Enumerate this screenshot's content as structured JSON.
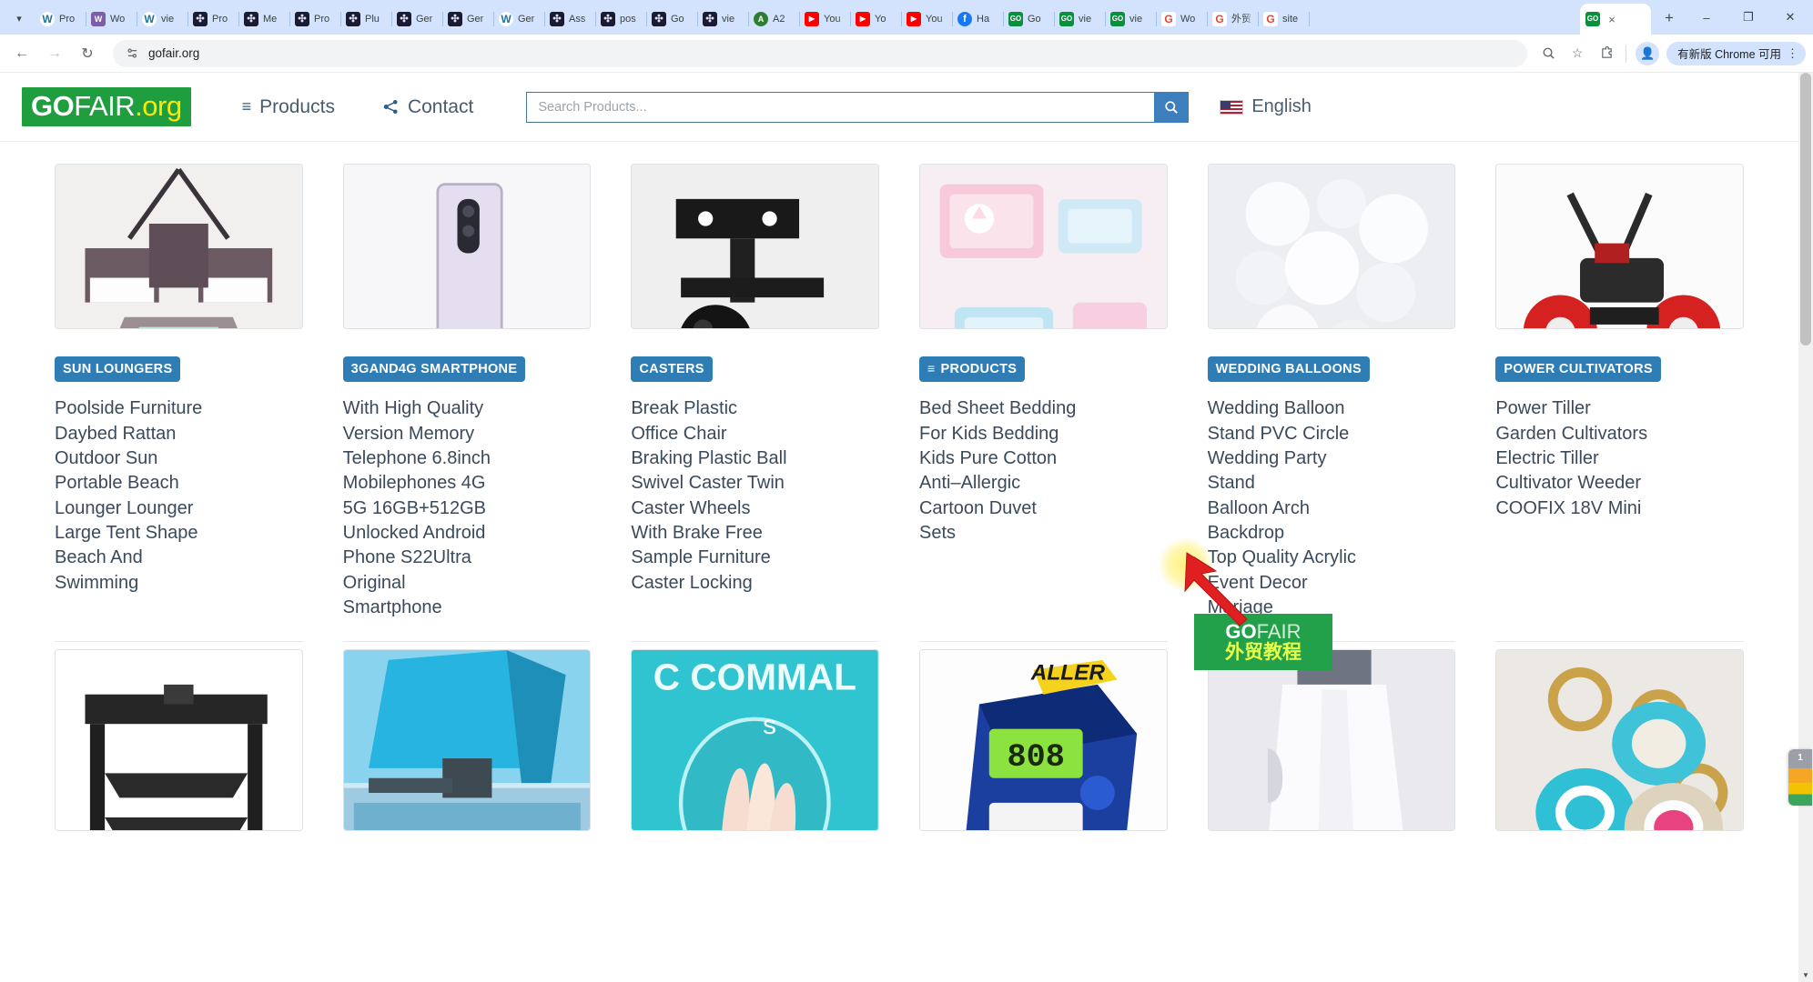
{
  "browser": {
    "tab_search_icon": "chevron-down-icon",
    "tabs": [
      {
        "title": "Pro",
        "fav": "wp"
      },
      {
        "title": "Wo",
        "fav": "w"
      },
      {
        "title": "vie",
        "fav": "wp"
      },
      {
        "title": "Pro",
        "fav": "dk"
      },
      {
        "title": "Me",
        "fav": "dk"
      },
      {
        "title": "Pro",
        "fav": "dk"
      },
      {
        "title": "Plu",
        "fav": "dk"
      },
      {
        "title": "Ger",
        "fav": "dk"
      },
      {
        "title": "Ger",
        "fav": "dk"
      },
      {
        "title": "Ger",
        "fav": "wp"
      },
      {
        "title": "Ass",
        "fav": "dk"
      },
      {
        "title": "pos",
        "fav": "dk"
      },
      {
        "title": "Go",
        "fav": "dk"
      },
      {
        "title": "vie",
        "fav": "dk"
      },
      {
        "title": "A2",
        "fav": "a2"
      },
      {
        "title": "You",
        "fav": "yt"
      },
      {
        "title": "Yo",
        "fav": "yt"
      },
      {
        "title": "You",
        "fav": "yt"
      },
      {
        "title": "Ha",
        "fav": "fb"
      },
      {
        "title": "Go",
        "fav": "gn"
      },
      {
        "title": "vie",
        "fav": "gn"
      },
      {
        "title": "vie",
        "fav": "gn"
      },
      {
        "title": "Wo",
        "fav": "g"
      },
      {
        "title": "外贸",
        "fav": "g"
      },
      {
        "title": "site",
        "fav": "g"
      }
    ],
    "active_tab": {
      "title": "GO",
      "fav_text": "GO",
      "close_label": "×"
    },
    "new_tab_label": "+",
    "window_controls": {
      "minimize": "–",
      "maximize": "❐",
      "close": "✕"
    },
    "nav": {
      "back": "←",
      "forward": "→",
      "reload": "↻"
    },
    "omnibox": {
      "site_settings_icon": "tune-icon",
      "url": "gofair.org"
    },
    "toolbar_icons": {
      "zoom": "magnifier-icon",
      "bookmark": "star-icon",
      "extensions": "puzzle-piece-icon",
      "profile": "avatar-icon",
      "menu": "kebab-menu-icon"
    },
    "update_chip": "有新版 Chrome 可用"
  },
  "site": {
    "logo": {
      "go": "GO",
      "fair": "FAIR",
      "org": ".org"
    },
    "nav": [
      {
        "label": "Products",
        "icon": "hamburger-icon"
      },
      {
        "label": "Contact",
        "icon": "share-icon"
      }
    ],
    "search": {
      "placeholder": "Search Products...",
      "value": "",
      "button_icon": "search-icon"
    },
    "language": {
      "label": "English",
      "flag": "us-flag-icon"
    }
  },
  "columns": [
    {
      "badge": "SUN LOUNGERS",
      "badge_prefix": "",
      "image": "outdoor-rattan-lounger-set",
      "links": [
        "Poolside Furniture",
        "Daybed Rattan",
        "Outdoor Sun",
        "Portable Beach",
        "Lounger Lounger",
        "Large Tent Shape",
        "Beach And",
        "Swimming"
      ]
    },
    {
      "badge": "3GAND4G SMARTPHONE",
      "badge_prefix": "",
      "image": "white-smartphone-back",
      "links": [
        "With High Quality",
        "Version Memory",
        "Telephone 6.8inch",
        "Mobilephones 4G",
        "5G 16GB+512GB",
        "Unlocked Android",
        "Phone S22Ultra",
        "Original",
        "Smartphone"
      ]
    },
    {
      "badge": "CASTERS",
      "badge_prefix": "",
      "image": "black-caster-wheel-bracket",
      "links": [
        "Break Plastic",
        "Office Chair",
        "Braking Plastic Ball",
        "Swivel Caster Twin",
        "Caster Wheels",
        "With Brake Free",
        "Sample Furniture",
        "Caster Locking"
      ]
    },
    {
      "badge": "PRODUCTS",
      "badge_prefix": "≡",
      "image": "kids-bedding-sets",
      "links": [
        "Bed Sheet Bedding",
        "For Kids Bedding",
        "Kids Pure Cotton",
        "Anti–Allergic",
        "Cartoon Duvet",
        "Sets"
      ]
    },
    {
      "badge": "WEDDING BALLOONS",
      "badge_prefix": "",
      "image": "white-balloon-arch",
      "links": [
        "Wedding Balloon",
        "Stand PVC Circle",
        "Wedding Party",
        "Stand",
        "Balloon Arch",
        "Backdrop",
        "Top Quality Acrylic",
        "Event Decor",
        "Mariage"
      ]
    },
    {
      "badge": "POWER CULTIVATORS",
      "badge_prefix": "",
      "image": "red-power-cultivator-tiller",
      "links": [
        "Power Tiller",
        "Garden Cultivators",
        "Electric Tiller",
        "Cultivator Weeder",
        "COOFIX 18V Mini"
      ]
    }
  ],
  "row2_images": [
    "black-metal-folding-cart",
    "blue-car-rooftop-tent",
    "teal-nail-care-graphic",
    "blue-digital-flow-meter",
    "white-dress-garment",
    "tennis-ball-keychains"
  ],
  "overlay": {
    "watermark_top_a": "GO",
    "watermark_top_b": "FAIR",
    "watermark_bottom": "外贸教程",
    "cursor": "red-arrow-cursor"
  },
  "colors": {
    "brand_green": "#1e9e3e",
    "badge_blue": "#2e7db5",
    "link_text": "#3a4a5b",
    "search_border": "#43788f",
    "search_button": "#3d7ebc",
    "watermark_green": "#23a14a",
    "watermark_yellow": "#eaff4a"
  }
}
